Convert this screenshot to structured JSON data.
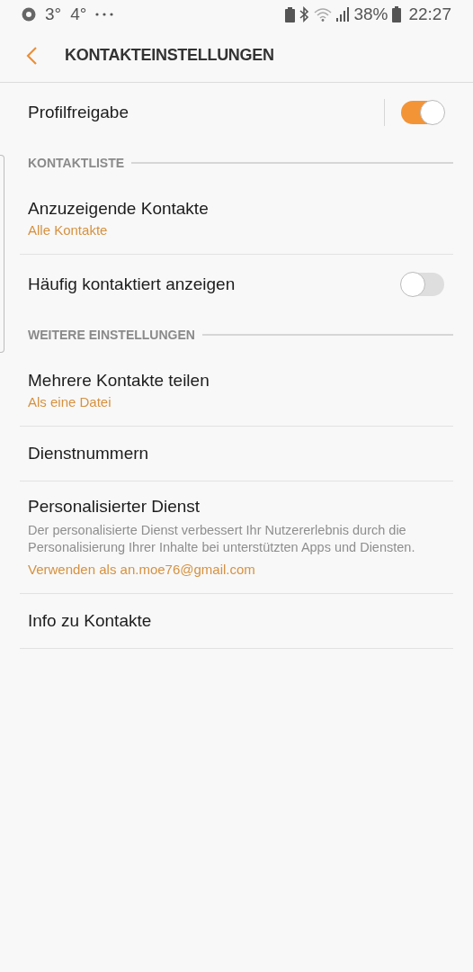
{
  "status_bar": {
    "temps": [
      "3°",
      "4°"
    ],
    "battery": "38%",
    "time": "22:27"
  },
  "header": {
    "title": "KONTAKTEINSTELLUNGEN"
  },
  "items": [
    {
      "kind": "toggle",
      "label": "Profilfreigabe",
      "on": true,
      "split": true
    },
    {
      "kind": "section",
      "title": "KONTAKTLISTE"
    },
    {
      "kind": "entry",
      "label": "Anzuzeigende Kontakte",
      "summary": "Alle Kontakte"
    },
    {
      "kind": "toggle",
      "label": "Häufig kontaktiert anzeigen",
      "on": false,
      "split": false
    },
    {
      "kind": "section",
      "title": "WEITERE EINSTELLUNGEN"
    },
    {
      "kind": "entry",
      "label": "Mehrere Kontakte teilen",
      "summary": "Als eine Datei"
    },
    {
      "kind": "entry",
      "label": "Dienstnummern"
    },
    {
      "kind": "entry",
      "label": "Personalisierter Dienst",
      "description": "Der personalisierte Dienst verbessert Ihr Nutzererlebnis durch die Personalisierung Ihrer Inhalte bei unterstützten Apps und Diensten.",
      "summary": "Verwenden als an.moe76@gmail.com"
    },
    {
      "kind": "entry",
      "label": "Info zu Kontakte"
    }
  ]
}
